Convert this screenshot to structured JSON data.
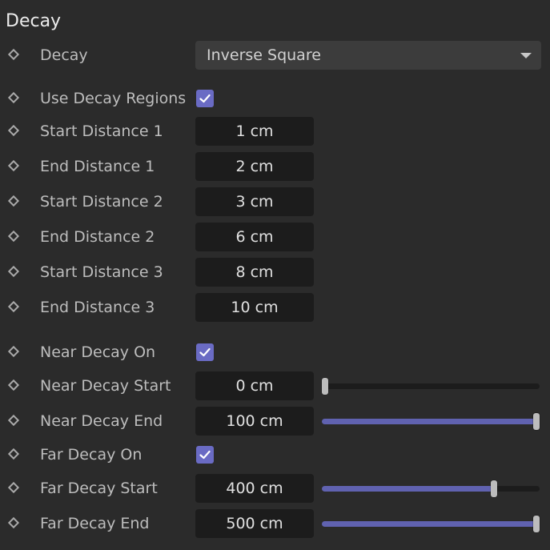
{
  "section": {
    "title": "Decay"
  },
  "decay_mode": {
    "label": "Decay",
    "value": "Inverse Square"
  },
  "use_decay_regions": {
    "label": "Use Decay Regions",
    "checked": true
  },
  "regions": [
    {
      "label": "Start Distance 1",
      "value": "1 cm"
    },
    {
      "label": "End Distance 1",
      "value": "2 cm"
    },
    {
      "label": "Start Distance 2",
      "value": "3 cm"
    },
    {
      "label": "End Distance 2",
      "value": "6 cm"
    },
    {
      "label": "Start Distance 3",
      "value": "8 cm"
    },
    {
      "label": "End Distance 3",
      "value": "10 cm"
    }
  ],
  "near_decay_on": {
    "label": "Near Decay On",
    "checked": true
  },
  "near_decay_start": {
    "label": "Near Decay Start",
    "value": "0 cm",
    "slider_level": 0.0
  },
  "near_decay_end": {
    "label": "Near Decay End",
    "value": "100 cm",
    "slider_level": 1.0
  },
  "far_decay_on": {
    "label": "Far Decay On",
    "checked": true
  },
  "far_decay_start": {
    "label": "Far Decay Start",
    "value": "400 cm",
    "slider_level": 0.8
  },
  "far_decay_end": {
    "label": "Far Decay End",
    "value": "500 cm",
    "slider_level": 1.0
  },
  "colors": {
    "background": "#2b2b2b",
    "accent": "#6a6bc4",
    "slider_fill": "#6062b0",
    "field_bg": "#1c1c1c",
    "dropdown_bg": "#3c3c3c"
  },
  "icons": {
    "keyframe": "keyframe-diamond-icon",
    "check": "checkmark-icon",
    "dropdown": "chevron-down-icon"
  }
}
